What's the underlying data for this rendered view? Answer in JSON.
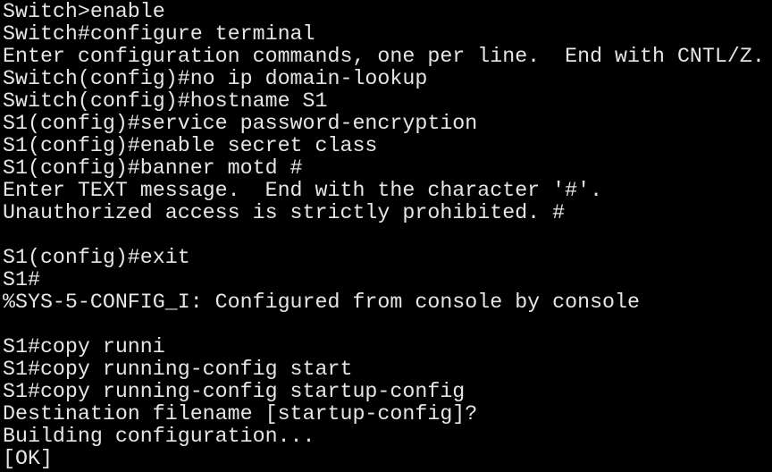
{
  "terminal": {
    "colors": {
      "background": "#000000",
      "foreground": "#e6e6e6"
    },
    "lines": [
      "Switch>enable",
      "Switch#configure terminal",
      "Enter configuration commands, one per line.  End with CNTL/Z.",
      "Switch(config)#no ip domain-lookup",
      "Switch(config)#hostname S1",
      "S1(config)#service password-encryption",
      "S1(config)#enable secret class",
      "S1(config)#banner motd #",
      "Enter TEXT message.  End with the character '#'.",
      "Unauthorized access is strictly prohibited. #",
      "",
      "S1(config)#exit",
      "S1#",
      "%SYS-5-CONFIG_I: Configured from console by console",
      "",
      "S1#copy runni",
      "S1#copy running-config start",
      "S1#copy running-config startup-config",
      "Destination filename [startup-config]?",
      "Building configuration...",
      "[OK]"
    ]
  }
}
